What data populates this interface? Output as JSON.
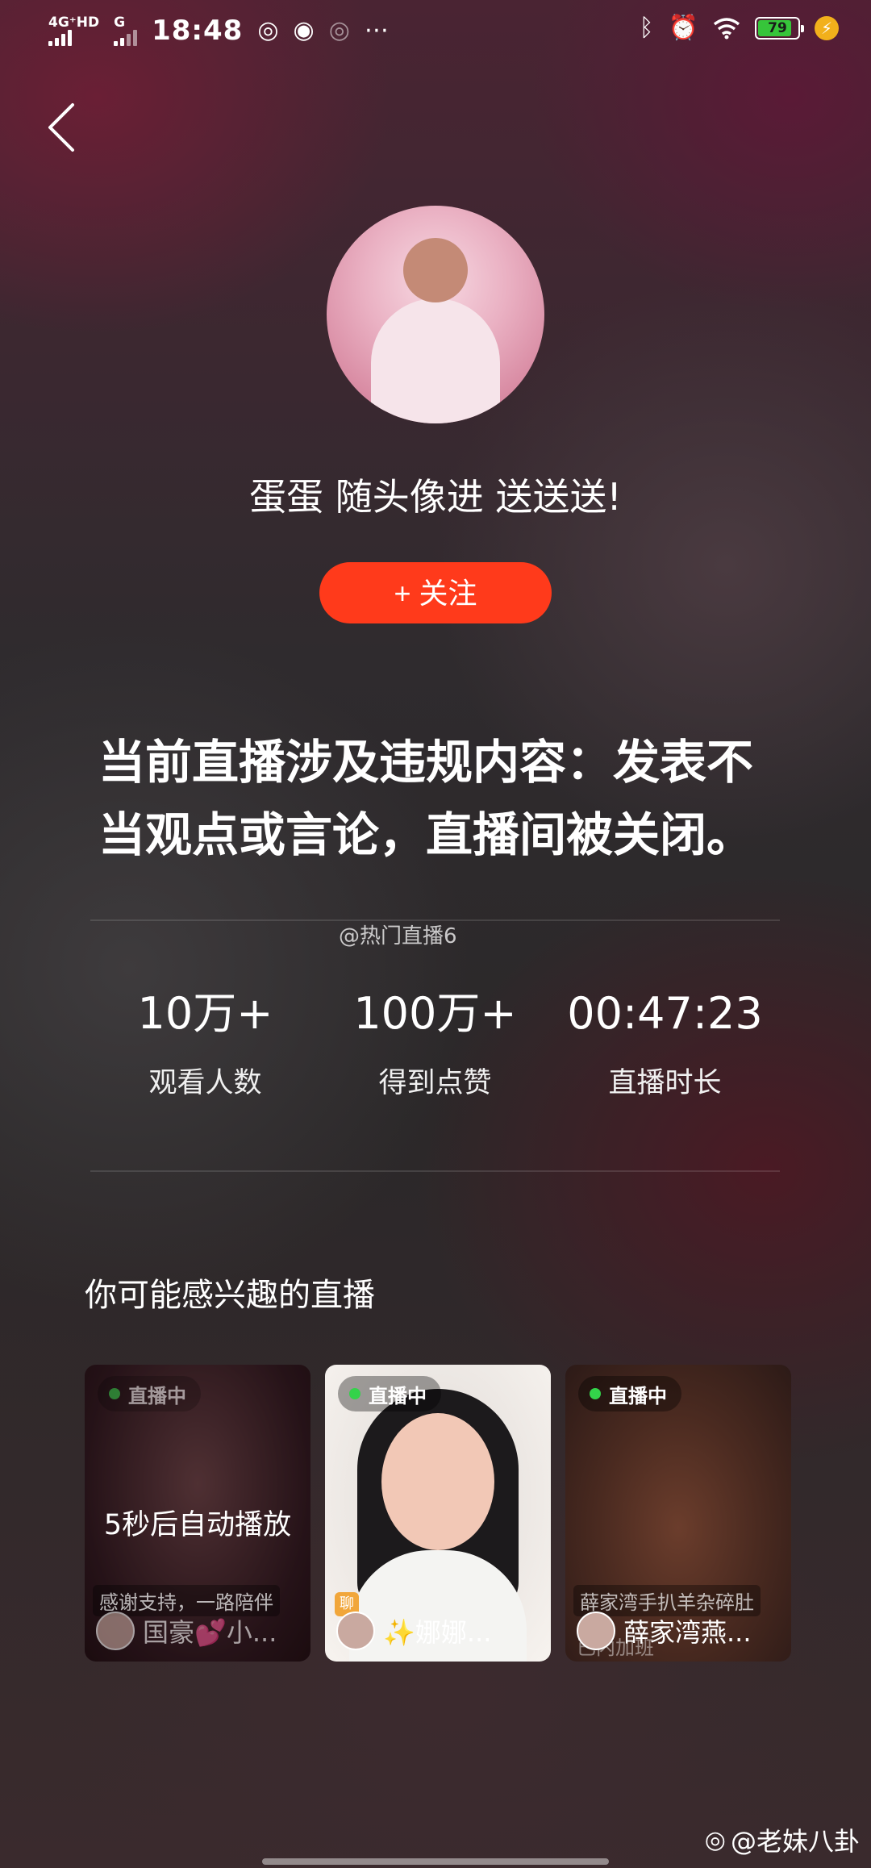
{
  "status_bar": {
    "network_1": "4G⁺HD",
    "network_2": "G",
    "time": "18:48",
    "battery": "79"
  },
  "streamer": {
    "name": "蛋蛋 随头像进 送送送!",
    "follow_label": "+ 关注"
  },
  "notice": "当前直播涉及违规内容：发表不当观点或言论，直播间被关闭。",
  "watermark_mid": "@热门直播6",
  "stats": [
    {
      "value": "10万+",
      "label": "观看人数"
    },
    {
      "value": "100万+",
      "label": "得到点赞"
    },
    {
      "value": "00:47:23",
      "label": "直播时长"
    }
  ],
  "recommend": {
    "title": "你可能感兴趣的直播",
    "cards": [
      {
        "badge": "直播中",
        "overlay": "5秒后自动播放",
        "subtitle": "感谢支持，一路陪伴",
        "owner": "国豪💕小..."
      },
      {
        "badge": "直播中",
        "owner": "✨娜娜...",
        "chip": "聊"
      },
      {
        "badge": "直播中",
        "subtitle": "薛家湾手扒羊杂碎肚",
        "subtitle2": "已内加班",
        "owner": "薛家湾燕..."
      }
    ]
  },
  "watermark_bottom": "@老妹八卦",
  "colors": {
    "follow_button": "#ff3a1b",
    "live_dot": "#33d34a"
  }
}
